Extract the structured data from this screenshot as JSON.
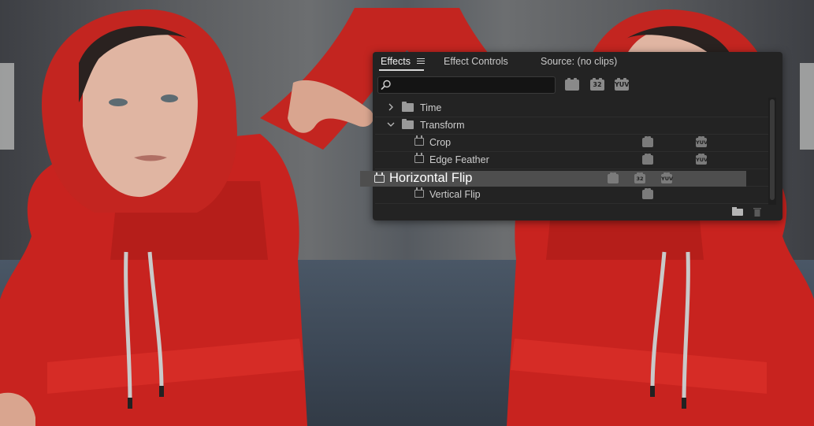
{
  "panel": {
    "tabs": [
      {
        "label": "Effects",
        "active": true
      },
      {
        "label": "Effect Controls",
        "active": false
      },
      {
        "label": "Source: (no clips)",
        "active": false
      }
    ],
    "search": {
      "value": "",
      "placeholder": ""
    },
    "filter_badges": [
      {
        "name": "accelerated-effects-icon",
        "label": ""
      },
      {
        "name": "32-bit-color-icon",
        "label": "32"
      },
      {
        "name": "yuv-effects-icon",
        "label": "YUV"
      }
    ],
    "tree": [
      {
        "label": "Time",
        "type": "folder",
        "expanded": false
      },
      {
        "label": "Transform",
        "type": "folder",
        "expanded": true
      },
      {
        "label": "Crop",
        "type": "effect",
        "badges": [
          "accelerated",
          "yuv"
        ]
      },
      {
        "label": "Edge Feather",
        "type": "effect",
        "badges": [
          "accelerated",
          "yuv"
        ]
      },
      {
        "label": "Horizontal Flip",
        "type": "effect",
        "selected": true,
        "badges": [
          "accelerated",
          "32",
          "yuv"
        ]
      },
      {
        "label": "Vertical Flip",
        "type": "effect",
        "badges": [
          "accelerated"
        ]
      }
    ],
    "footer": {
      "new_bin_icon": "folder-icon",
      "delete_icon": "trash-icon"
    }
  },
  "colors": {
    "panel_bg": "#232323",
    "highlight_bg": "#4e4e4e",
    "hoodie_red": "#c8231f",
    "text": "#cdcdcd"
  }
}
